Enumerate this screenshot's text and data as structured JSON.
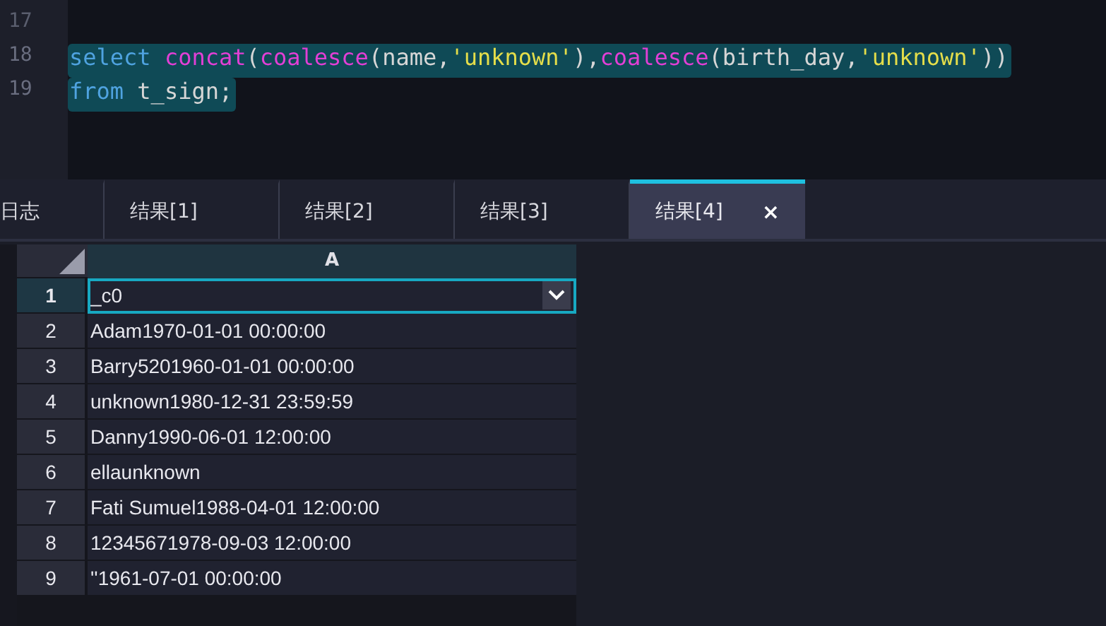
{
  "editor": {
    "lines": [
      {
        "number": "17",
        "selected": false
      },
      {
        "number": "18",
        "selected": true,
        "tokens": [
          {
            "kind": "keyword",
            "text": "select"
          },
          {
            "kind": "function",
            "text": "concat",
            "space_before": true
          },
          {
            "kind": "plain",
            "text": "("
          },
          {
            "kind": "function",
            "text": "coalesce"
          },
          {
            "kind": "plain",
            "text": "(name,"
          },
          {
            "kind": "string",
            "text": "'unknown'"
          },
          {
            "kind": "plain",
            "text": "),"
          },
          {
            "kind": "function",
            "text": "coalesce"
          },
          {
            "kind": "plain",
            "text": "(birth_day,"
          },
          {
            "kind": "string",
            "text": "'unknown'"
          },
          {
            "kind": "plain",
            "text": "))"
          }
        ]
      },
      {
        "number": "19",
        "selected": true,
        "tokens": [
          {
            "kind": "keyword",
            "text": "from"
          },
          {
            "kind": "plain",
            "text": "t_sign;",
            "space_before": true
          }
        ]
      }
    ]
  },
  "tabs": [
    {
      "label": "日志",
      "selected": false
    },
    {
      "label": "结果[1]",
      "selected": false
    },
    {
      "label": "结果[2]",
      "selected": false
    },
    {
      "label": "结果[3]",
      "selected": false
    },
    {
      "label": "结果[4]",
      "selected": true,
      "close": "×"
    }
  ],
  "grid": {
    "columns": [
      "A"
    ],
    "rows": [
      {
        "number": "1",
        "value": "_c0",
        "selected": true
      },
      {
        "number": "2",
        "value": "Adam1970-01-01 00:00:00",
        "selected": false
      },
      {
        "number": "3",
        "value": "Barry5201960-01-01 00:00:00",
        "selected": false
      },
      {
        "number": "4",
        "value": "unknown1980-12-31 23:59:59",
        "selected": false
      },
      {
        "number": "5",
        "value": "Danny1990-06-01 12:00:00",
        "selected": false
      },
      {
        "number": "6",
        "value": "ellaunknown",
        "selected": false
      },
      {
        "number": "7",
        "value": "Fati Sumuel1988-04-01 12:00:00",
        "selected": false
      },
      {
        "number": "8",
        "value": "12345671978-09-03 12:00:00",
        "selected": false
      },
      {
        "number": "9",
        "value": "''1961-07-01 00:00:00",
        "selected": false
      }
    ]
  }
}
